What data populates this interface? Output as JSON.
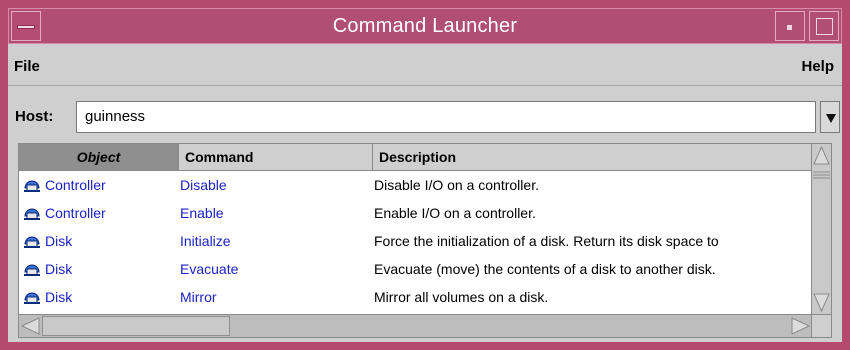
{
  "window": {
    "title": "Command Launcher",
    "accent_color": "#b5496e"
  },
  "menubar": {
    "file_label": "File",
    "help_label": "Help"
  },
  "host": {
    "label": "Host:",
    "value": "guinness"
  },
  "table": {
    "columns": [
      "Object",
      "Command",
      "Description"
    ],
    "sorted_column": "Object",
    "rows": [
      {
        "object": "Controller",
        "command": "Disable",
        "description": "Disable I/O on a controller.",
        "icon": "disk-object-icon"
      },
      {
        "object": "Controller",
        "command": "Enable",
        "description": "Enable I/O on a controller.",
        "icon": "disk-object-icon"
      },
      {
        "object": "Disk",
        "command": "Initialize",
        "description": "Force the initialization of a disk. Return its disk space to",
        "icon": "disk-object-icon"
      },
      {
        "object": "Disk",
        "command": "Evacuate",
        "description": "Evacuate (move) the contents of a disk to another disk.",
        "icon": "disk-object-icon"
      },
      {
        "object": "Disk",
        "command": "Mirror",
        "description": "Mirror all volumes on a disk.",
        "icon": "disk-object-icon"
      }
    ]
  }
}
